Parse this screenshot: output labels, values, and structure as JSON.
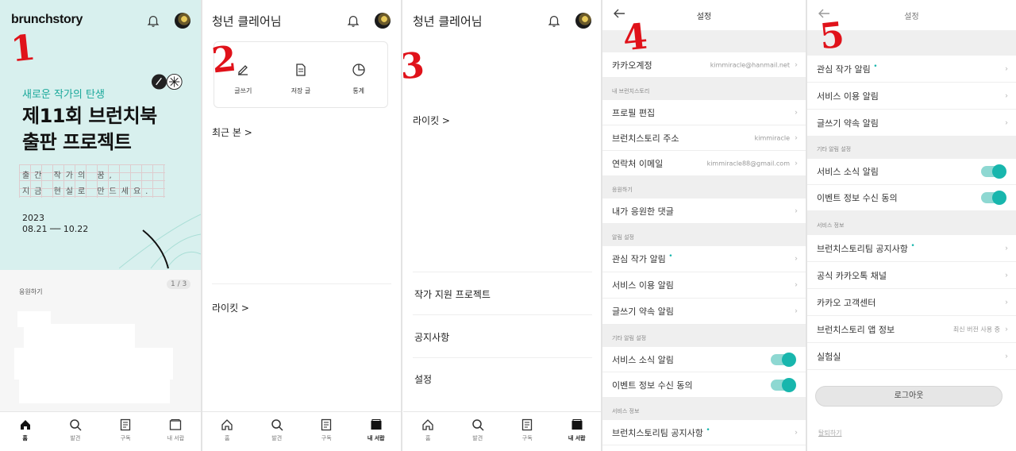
{
  "panel1": {
    "logo": "brunchstory",
    "step": "1",
    "banner": {
      "subtitle": "새로운 작가의 탄생",
      "title_line1": "제11회 브런치북",
      "title_line2": "출판 프로젝트",
      "grid_line1": "출간 작가의 꿈,",
      "grid_line2": "지금 현실로 만드세요.",
      "year": "2023",
      "dates": "08.21 ── 10.22"
    },
    "pager": "1 / 3",
    "section": "응원하기"
  },
  "panel2": {
    "step": "2",
    "title": "청년 클레어님",
    "card": [
      "글쓰기",
      "저장 글",
      "통계"
    ],
    "recent": "최근 본 >",
    "likeit": "라이킷 >"
  },
  "panel3": {
    "step": "3",
    "title": "청년 클레어님",
    "likeit": "라이킷 >",
    "menu": [
      "작가 지원 프로젝트",
      "공지사항",
      "설정"
    ]
  },
  "tabs": [
    "홈",
    "발견",
    "구독",
    "내 서랍"
  ],
  "panel4": {
    "step": "4",
    "title": "설정",
    "rows": {
      "kakao_label": "카카오계정",
      "kakao_value": "kimmiracle@hanmail.net",
      "group_brunch": "내 브런치스토리",
      "profile": "프로필 편집",
      "address_label": "브런치스토리 주소",
      "address_value": "kimmiracle",
      "email_label": "연락처 이메일",
      "email_value": "kimmiracle88@gmail.com",
      "group_cheer": "응원하기",
      "cheer_comments": "내가 응원한 댓글",
      "group_alarm": "알림 설정",
      "fav_author": "관심 작가 알림",
      "service_use": "서비스 이용 알림",
      "writing_promise": "글쓰기 약속 알림",
      "group_other": "기타 알림 설정",
      "service_news": "서비스 소식 알림",
      "event_consent": "이벤트 정보 수신 동의",
      "group_service": "서비스 정보",
      "team_notice": "브런치스토리팀 공지사항"
    }
  },
  "panel5": {
    "step": "5",
    "title": "설정",
    "rows": {
      "fav_author": "관심 작가 알림",
      "service_use": "서비스 이용 알림",
      "writing_promise": "글쓰기 약속 알림",
      "group_other": "기타 알림 설정",
      "service_news": "서비스 소식 알림",
      "event_consent": "이벤트 정보 수신 동의",
      "group_service": "서비스 정보",
      "team_notice": "브런치스토리팀 공지사항",
      "kakao_channel": "공식 카카오톡 채널",
      "kakao_cs": "카카오 고객센터",
      "app_info": "브런치스토리 앱 정보",
      "app_version": "최신 버전 사용 중",
      "lab": "실험실"
    },
    "logout": "로그아웃",
    "withdraw": "탈퇴하기"
  },
  "colors": {
    "accent": "#18b6ad",
    "banner_bg": "#d8f0ee",
    "step": "#e0121a"
  }
}
